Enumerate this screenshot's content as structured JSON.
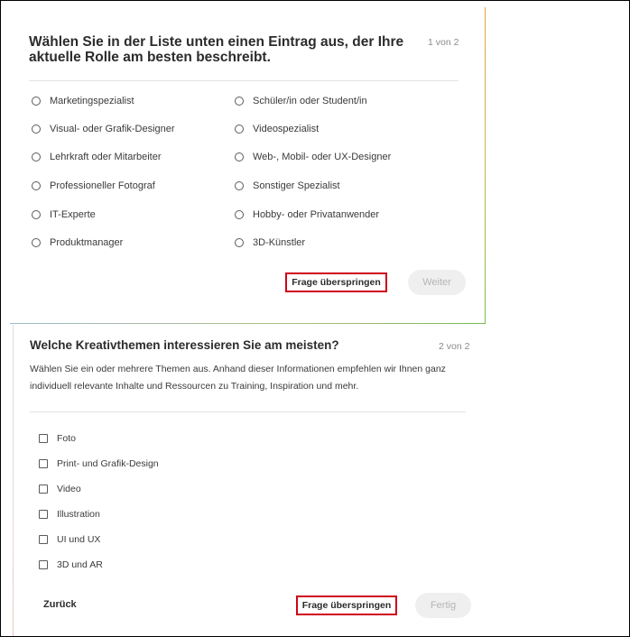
{
  "question1": {
    "title": "Wählen Sie in der Liste unten einen Eintrag aus, der Ihre aktuelle Rolle am besten beschreibt.",
    "step": "1 von 2",
    "options_left": [
      "Marketingspezialist",
      "Visual- oder Grafik-Designer",
      "Lehrkraft oder Mitarbeiter",
      "Professioneller Fotograf",
      "IT-Experte",
      "Produktmanager"
    ],
    "options_right": [
      "Schüler/in oder Student/in",
      "Videospezialist",
      "Web-, Mobil- oder UX-Designer",
      "Sonstiger Spezialist",
      "Hobby- oder Privatanwender",
      "3D-Künstler"
    ],
    "skip_label": "Frage überspringen",
    "next_label": "Weiter"
  },
  "question2": {
    "title": "Welche Kreativthemen interessieren Sie am meisten?",
    "step": "2 von 2",
    "description": "Wählen Sie ein oder mehrere Themen aus. Anhand dieser Informationen empfehlen wir Ihnen ganz individuell relevante Inhalte und Ressourcen zu Training, Inspiration und mehr.",
    "options": [
      "Foto",
      "Print- und Grafik-Design",
      "Video",
      "Illustration",
      "UI und UX",
      "3D und AR"
    ],
    "back_label": "Zurück",
    "skip_label": "Frage überspringen",
    "finish_label": "Fertig"
  },
  "colors": {
    "highlight_border": "#d0021b",
    "disabled_button_bg": "#efefef",
    "disabled_button_text": "#b5b5b5"
  }
}
